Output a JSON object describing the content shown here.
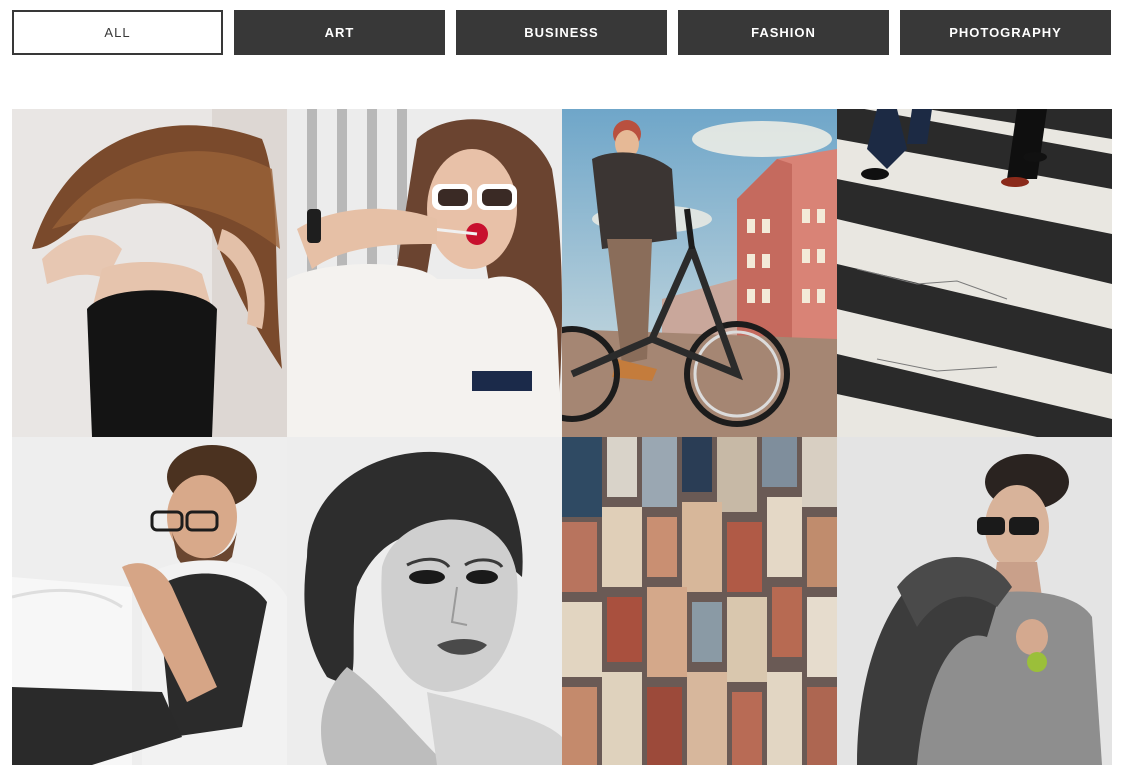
{
  "filters": [
    {
      "label": "ALL",
      "active": true
    },
    {
      "label": "ART",
      "active": false
    },
    {
      "label": "BUSINESS",
      "active": false
    },
    {
      "label": "FASHION",
      "active": false
    },
    {
      "label": "PHOTOGRAPHY",
      "active": false
    }
  ],
  "colors": {
    "button_dark": "#383838",
    "button_light": "#ffffff",
    "background": "#ffffff"
  },
  "gallery": [
    {
      "subject": "woman-flipping-hair-photo"
    },
    {
      "subject": "woman-sunglasses-lollipop-photo"
    },
    {
      "subject": "man-on-bicycle-city-photo"
    },
    {
      "subject": "crosswalk-pedestrians-photo"
    },
    {
      "subject": "bearded-man-glasses-sofa-photo"
    },
    {
      "subject": "black-and-white-woman-portrait-photo"
    },
    {
      "subject": "aerial-city-skyscrapers-photo"
    },
    {
      "subject": "man-glasses-jacket-over-shoulder-photo"
    }
  ]
}
